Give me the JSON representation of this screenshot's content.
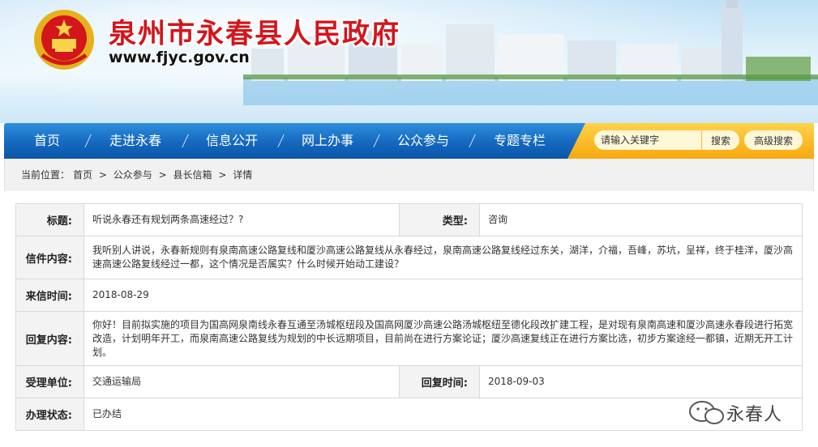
{
  "header": {
    "title": "泉州市永春县人民政府",
    "url": "www.fjyc.gov.cn"
  },
  "nav": {
    "items": [
      "首页",
      "走进永春",
      "信息公开",
      "网上办事",
      "公众参与",
      "专题专栏"
    ]
  },
  "search": {
    "placeholder": "请输入关键字",
    "search_label": "搜索",
    "advanced_label": "高级搜索"
  },
  "breadcrumb": {
    "prefix": "当前位置：",
    "items": [
      "首页",
      "公众参与",
      "县长信箱",
      "详情"
    ],
    "separator": ">"
  },
  "detail": {
    "title_label": "标题:",
    "title": "听说永春还有规划两条高速经过？?",
    "type_label": "类型:",
    "type": "咨询",
    "content_label": "信件内容:",
    "content": "我听别人讲说，永春新规则有泉南高速公路复线和厦沙高速公路复线从永春经过，泉南高速公路复线经过东关，湖洋，介福，吾峰，苏坑，呈祥，终于桂洋，厦沙高速高速公路复线经过一都，这个情况是否属实？什么时候开始动工建设？",
    "date_label": "来信时间:",
    "date": "2018-08-29",
    "reply_label": "回复内容:",
    "reply": "你好！目前拟实施的项目为国高网泉南线永春互通至汤城枢纽段及国高网厦沙高速公路汤城枢纽至德化段改扩建工程，是对现有泉南高速和厦沙高速永春段进行拓宽改造，计划明年开工，而泉南高速公路复线为规划的中长远期项目，目前尚在进行方案论证；厦沙高速复线正在进行方案比选，初步方案途经一都镇，近期无开工计划。",
    "unit_label": "受理单位:",
    "unit": "交通运输局",
    "reply_date_label": "回复时间:",
    "reply_date": "2018-09-03",
    "status_label": "办理状态:",
    "status": "已办结"
  },
  "watermark": {
    "text": "永春人"
  },
  "colors": {
    "title_red": "#d4151c",
    "nav_blue": "#1468bf",
    "search_orange": "#f7a90f"
  }
}
